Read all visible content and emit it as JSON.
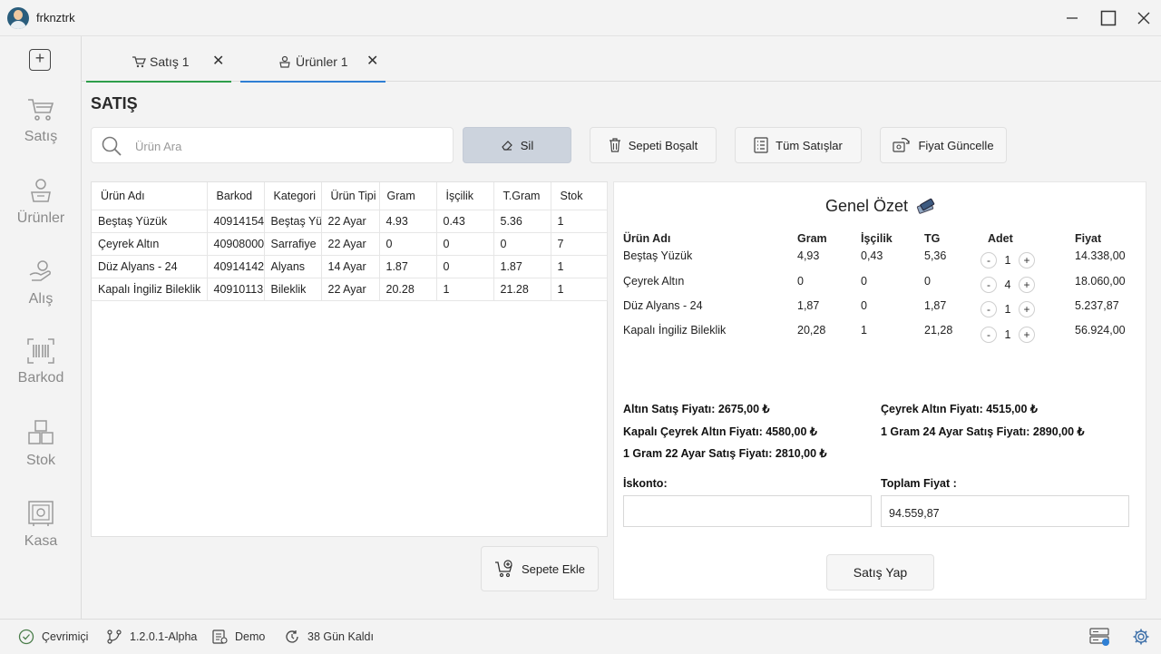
{
  "window": {
    "title": "frknztrk"
  },
  "sidebar": {
    "items": [
      {
        "label": "Satış",
        "icon": "cart-icon"
      },
      {
        "label": "Ürünler",
        "icon": "products-icon"
      },
      {
        "label": "Alış",
        "icon": "purchase-icon"
      },
      {
        "label": "Barkod",
        "icon": "barcode-icon"
      },
      {
        "label": "Stok",
        "icon": "boxes-icon"
      },
      {
        "label": "Kasa",
        "icon": "safe-icon"
      }
    ]
  },
  "tabs": [
    {
      "label": "Satış 1",
      "accent": "#2e9e4a"
    },
    {
      "label": "Ürünler 1",
      "accent": "#2f7fd4"
    }
  ],
  "page": {
    "title": "SATIŞ",
    "search_placeholder": "Ürün Ara",
    "buttons": {
      "sil": "Sil",
      "sepeti_bosalt": "Sepeti Boşalt",
      "tum_satislar": "Tüm Satışlar",
      "fiyat_guncelle": "Fiyat Güncelle",
      "sepete_ekle": "Sepete Ekle",
      "satis_yap": "Satış Yap"
    }
  },
  "products": {
    "headers": [
      "Ürün Adı",
      "Barkod",
      "Kategori",
      "Ürün Tipi",
      "Gram",
      "İşçilik",
      "T.Gram",
      "Stok"
    ],
    "rows": [
      [
        "Beştaş Yüzük",
        "40914154",
        "Beştaş Yüzük",
        "22 Ayar",
        "4.93",
        "0.43",
        "5.36",
        "1"
      ],
      [
        "Çeyrek Altın",
        "40908000",
        "Sarrafiye",
        "22 Ayar",
        "0",
        "0",
        "0",
        "7"
      ],
      [
        "Düz Alyans - 24",
        "40914142",
        "Alyans",
        "14 Ayar",
        "1.87",
        "0",
        "1.87",
        "1"
      ],
      [
        "Kapalı İngiliz Bileklik",
        "40910113",
        "Bileklik",
        "22 Ayar",
        "20.28",
        "1",
        "21.28",
        "1"
      ]
    ]
  },
  "summary": {
    "title": "Genel Özet",
    "headers": {
      "name": "Ürün Adı",
      "gram": "Gram",
      "iscilik": "İşçilik",
      "tg": "TG",
      "adet": "Adet",
      "fiyat": "Fiyat"
    },
    "rows": [
      {
        "name": "Beştaş Yüzük",
        "gram": "4,93",
        "iscilik": "0,43",
        "tg": "5,36",
        "adet": "1",
        "fiyat": "14.338,00"
      },
      {
        "name": "Çeyrek Altın",
        "gram": "0",
        "iscilik": "0",
        "tg": "0",
        "adet": "4",
        "fiyat": "18.060,00"
      },
      {
        "name": "Düz Alyans - 24",
        "gram": "1,87",
        "iscilik": "0",
        "tg": "1,87",
        "adet": "1",
        "fiyat": "5.237,87"
      },
      {
        "name": "Kapalı İngiliz Bileklik",
        "gram": "20,28",
        "iscilik": "1",
        "tg": "21,28",
        "adet": "1",
        "fiyat": "56.924,00"
      }
    ],
    "prices": {
      "altin_satis": "Altın Satış Fiyatı: 2675,00 ₺",
      "ceyrek_altin": "Çeyrek Altın Fiyatı: 4515,00 ₺",
      "kapali_ceyrek": "Kapalı Çeyrek Altın Fiyatı: 4580,00 ₺",
      "gram24": "1 Gram 24 Ayar Satış Fiyatı: 2890,00 ₺",
      "gram22": "1 Gram 22 Ayar Satış Fiyatı: 2810,00 ₺"
    },
    "iskonto_label": "İskonto:",
    "iskonto_value": "",
    "toplam_label": "Toplam Fiyat :",
    "toplam_value": "94.559,87"
  },
  "status": {
    "online": "Çevrimiçi",
    "version": "1.2.0.1-Alpha",
    "mode": "Demo",
    "days_left": "38 Gün Kaldı"
  }
}
